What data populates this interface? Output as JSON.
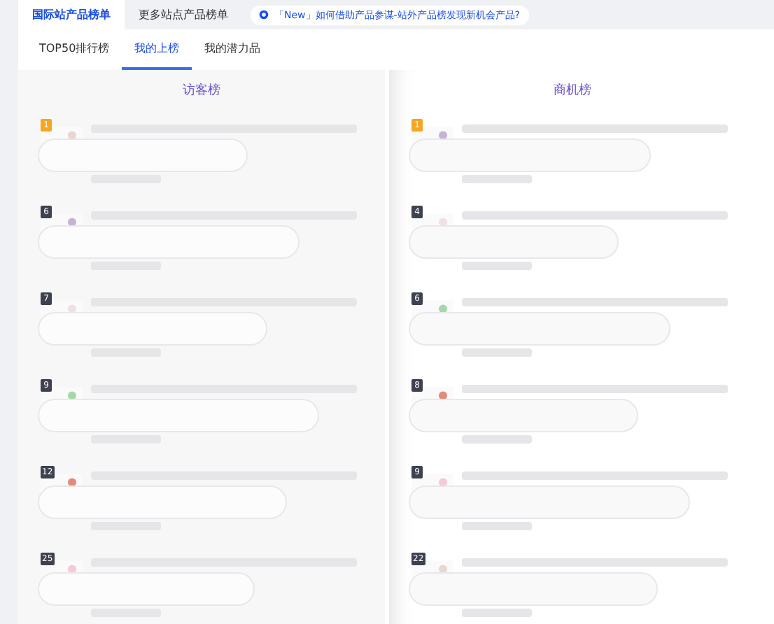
{
  "top_tabs": [
    {
      "label": "国际站产品榜单",
      "selected": true
    },
    {
      "label": "更多站点产品榜单",
      "selected": false
    }
  ],
  "notice": {
    "text": "「New」如何借助产品参谋-站外产品榜发现新机会产品?"
  },
  "sub_tabs": [
    {
      "label": "TOP50排行榜",
      "selected": false
    },
    {
      "label": "我的上榜",
      "selected": true
    },
    {
      "label": "我的潜力品",
      "selected": false
    }
  ],
  "boards": [
    {
      "title": "访客榜",
      "items": [
        {
          "rank": "1",
          "color": "#f5a623"
        },
        {
          "rank": "6",
          "color": "#3d4150"
        },
        {
          "rank": "7",
          "color": "#3d4150"
        },
        {
          "rank": "9",
          "color": "#3d4150"
        },
        {
          "rank": "12",
          "color": "#3d4150"
        },
        {
          "rank": "25",
          "color": "#3d4150"
        }
      ]
    },
    {
      "title": "商机榜",
      "items": [
        {
          "rank": "1",
          "color": "#f5a623"
        },
        {
          "rank": "4",
          "color": "#3d4150"
        },
        {
          "rank": "6",
          "color": "#3d4150"
        },
        {
          "rank": "8",
          "color": "#3d4150"
        },
        {
          "rank": "9",
          "color": "#3d4150"
        },
        {
          "rank": "22",
          "color": "#3d4150"
        }
      ]
    }
  ]
}
